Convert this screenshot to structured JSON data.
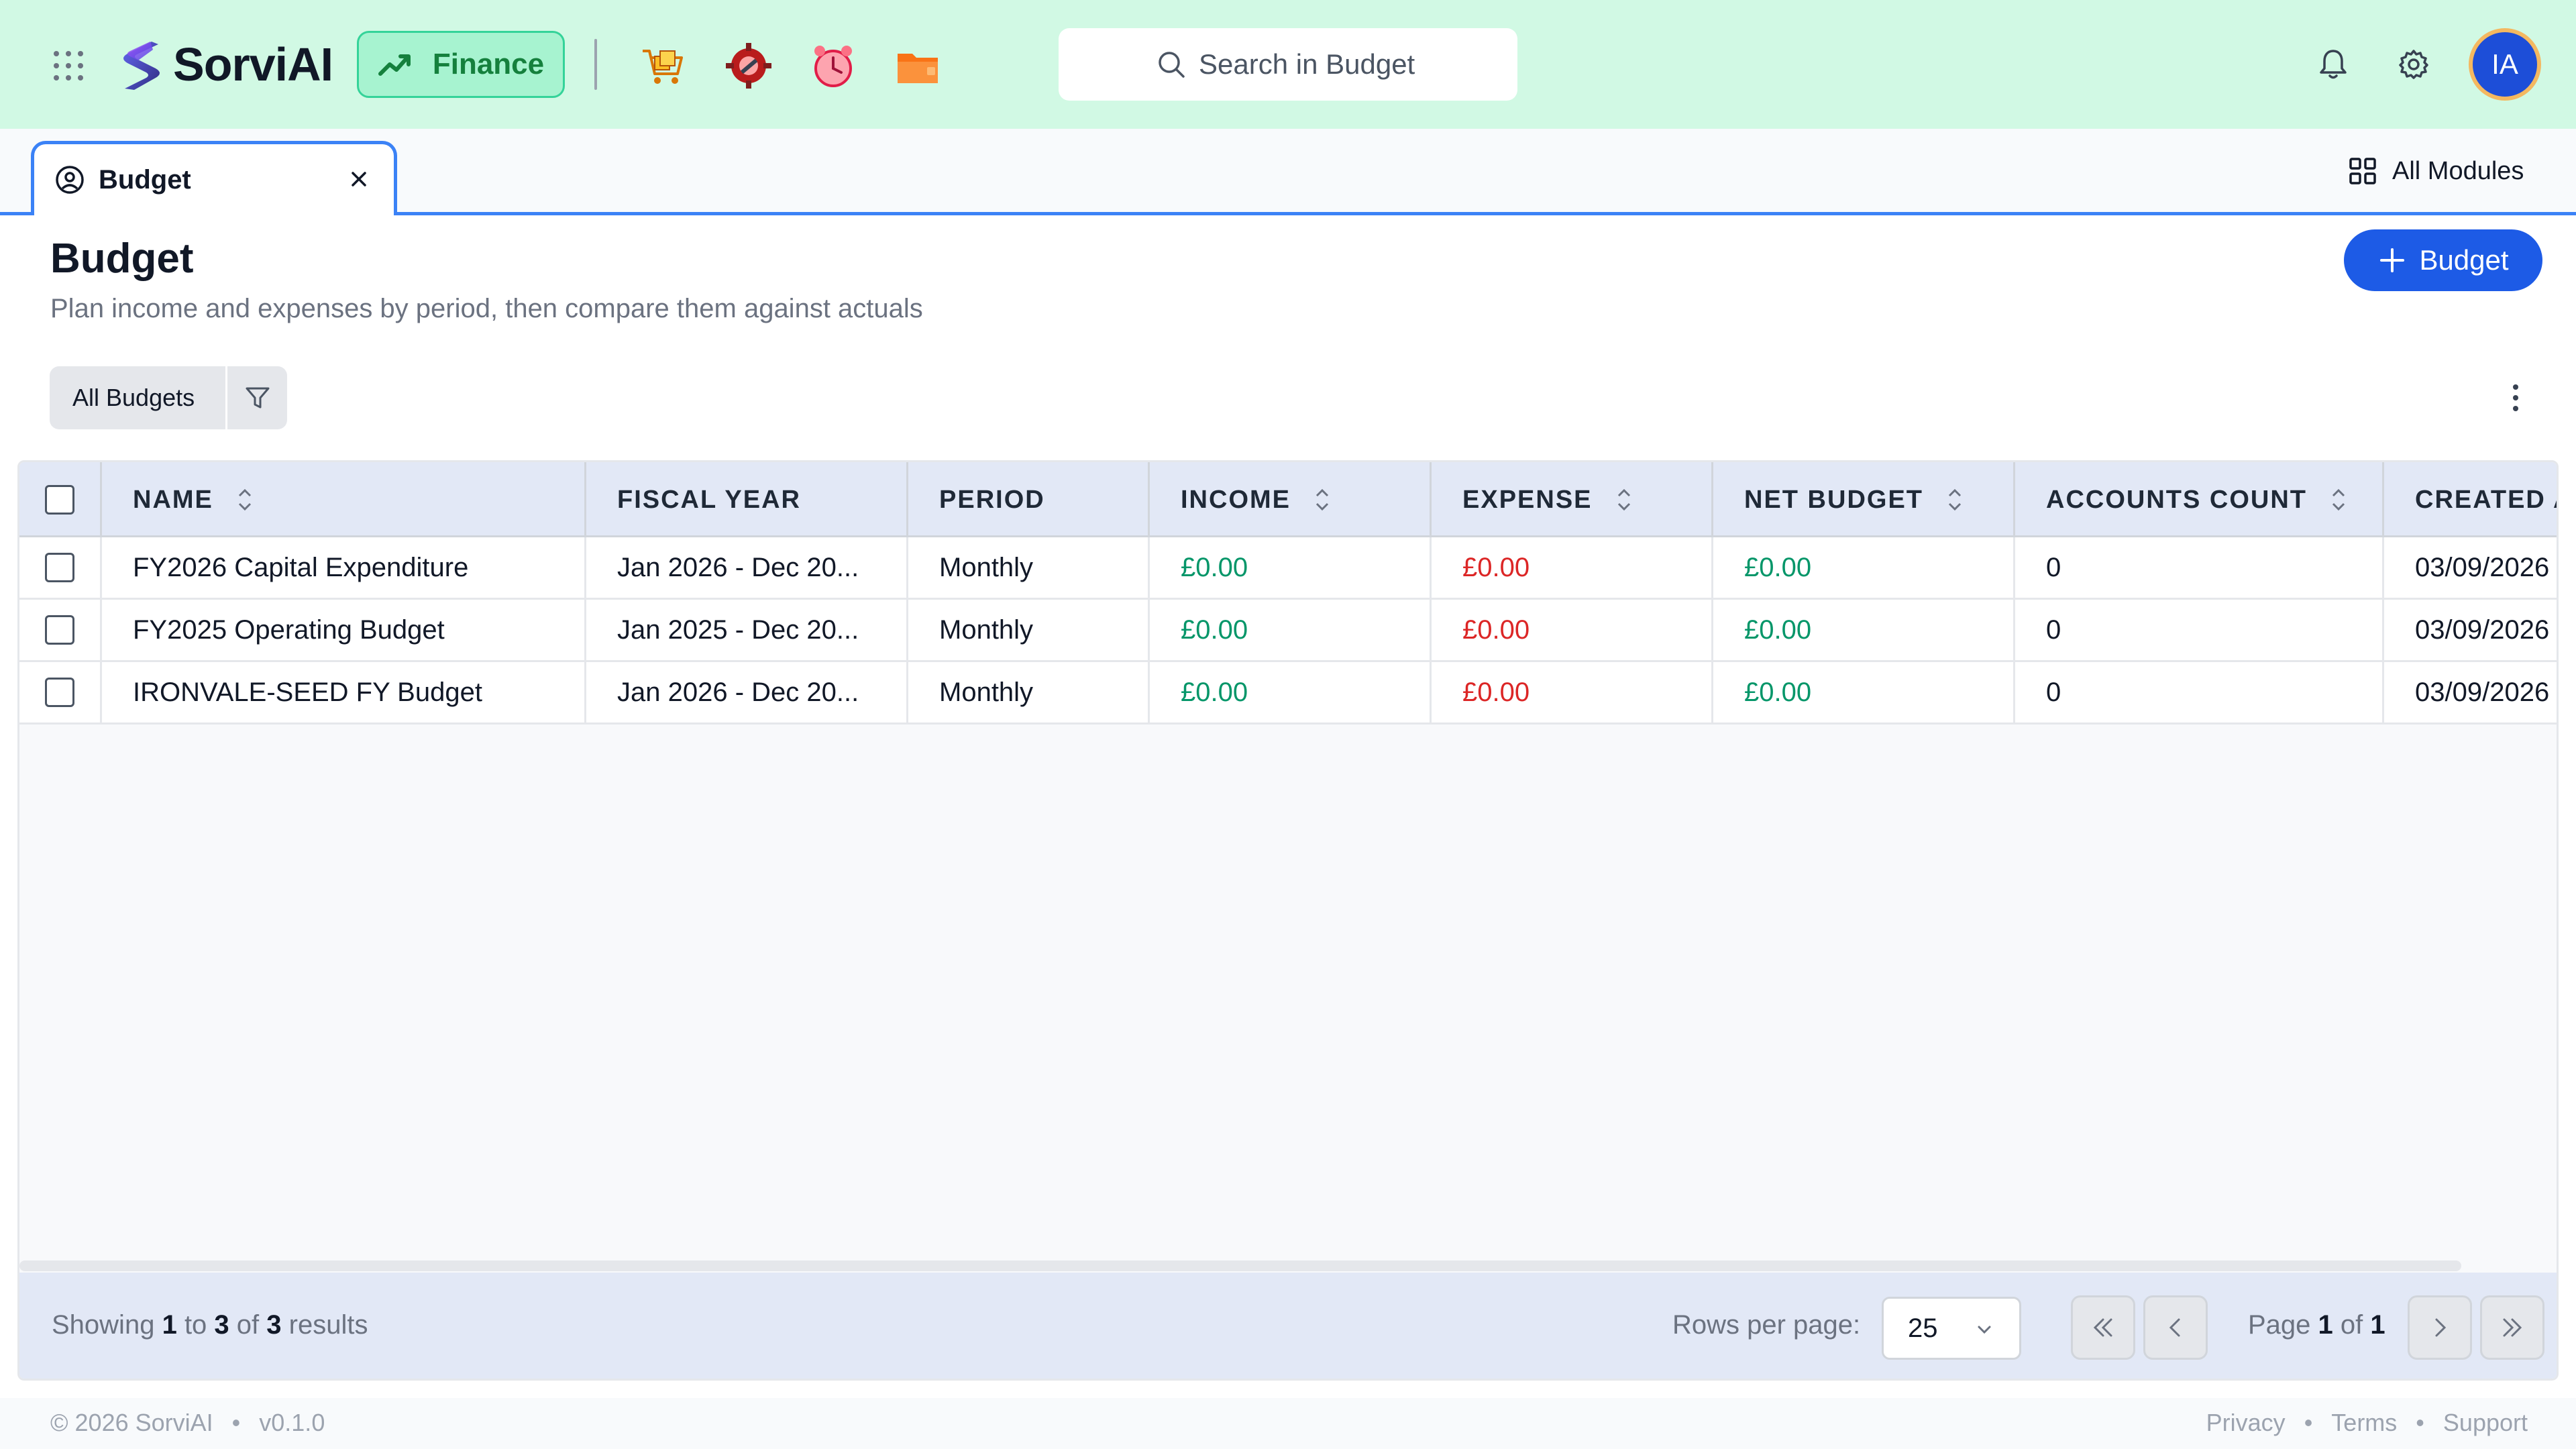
{
  "app": {
    "brand": "SorviAI",
    "module_label": "Finance",
    "search_placeholder": "Search in Budget",
    "user_initials": "IA",
    "accent_color": "#1d5be6",
    "header_bg": "#d1f9e4"
  },
  "tabs": [
    {
      "label": "Budget",
      "active": true
    }
  ],
  "all_modules_label": "All Modules",
  "page": {
    "title": "Budget",
    "subtitle": "Plan income and expenses by period, then compare them against actuals",
    "add_button_label": "Budget"
  },
  "filter": {
    "view_label": "All Budgets"
  },
  "table": {
    "columns": [
      "NAME",
      "FISCAL YEAR",
      "PERIOD",
      "INCOME",
      "EXPENSE",
      "NET BUDGET",
      "ACCOUNTS COUNT",
      "CREATED A"
    ],
    "rows": [
      {
        "name": "FY2026 Capital Expenditure",
        "fiscal_year": "Jan 2026 - Dec 20...",
        "period": "Monthly",
        "income": "£0.00",
        "expense": "£0.00",
        "net_budget": "£0.00",
        "accounts_count": "0",
        "created_at": "03/09/2026"
      },
      {
        "name": "FY2025 Operating Budget",
        "fiscal_year": "Jan 2025 - Dec 20...",
        "period": "Monthly",
        "income": "£0.00",
        "expense": "£0.00",
        "net_budget": "£0.00",
        "accounts_count": "0",
        "created_at": "03/09/2026"
      },
      {
        "name": "IRONVALE-SEED FY Budget",
        "fiscal_year": "Jan 2026 - Dec 20...",
        "period": "Monthly",
        "income": "£0.00",
        "expense": "£0.00",
        "net_budget": "£0.00",
        "accounts_count": "0",
        "created_at": "03/09/2026"
      }
    ]
  },
  "pagination": {
    "showing_prefix": "Showing",
    "from": "1",
    "to_word": "to",
    "to": "3",
    "of_word": "of",
    "total": "3",
    "results_word": "results",
    "rows_per_page_label": "Rows per page:",
    "rows_per_page_value": "25",
    "page_word": "Page",
    "current_page": "1",
    "page_of_word": "of",
    "total_pages": "1"
  },
  "footer": {
    "copyright": "© 2026 SorviAI",
    "version": "v0.1.0",
    "links": [
      "Privacy",
      "Terms",
      "Support"
    ]
  }
}
